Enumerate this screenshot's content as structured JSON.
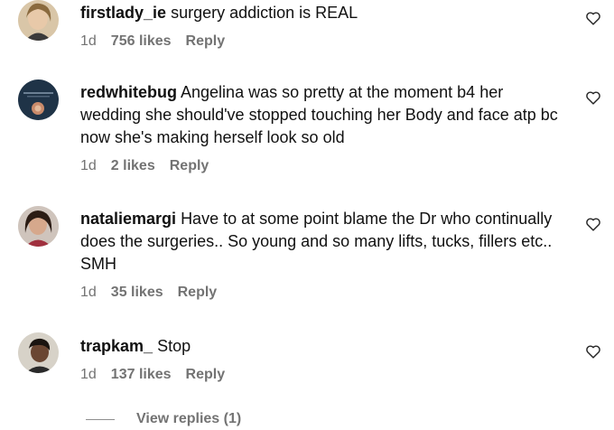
{
  "comments": [
    {
      "username": "firstlady_ie",
      "text": "surgery addiction is REAL",
      "time": "1d",
      "likes": "756 likes",
      "reply": "Reply"
    },
    {
      "username": "redwhitebug",
      "text": "Angelina was so pretty at the moment b4 her wedding she should've stopped touching her Body and face atp bc now she's making herself look so old",
      "time": "1d",
      "likes": "2 likes",
      "reply": "Reply"
    },
    {
      "username": "nataliemargi",
      "text": "Have to at some point blame the Dr who continually does the surgeries.. So young and so many lifts, tucks, fillers etc.. SMH",
      "time": "1d",
      "likes": "35 likes",
      "reply": "Reply"
    },
    {
      "username": "trapkam_",
      "text": "Stop",
      "time": "1d",
      "likes": "137 likes",
      "reply": "Reply"
    }
  ],
  "view_replies": "View replies (1)"
}
